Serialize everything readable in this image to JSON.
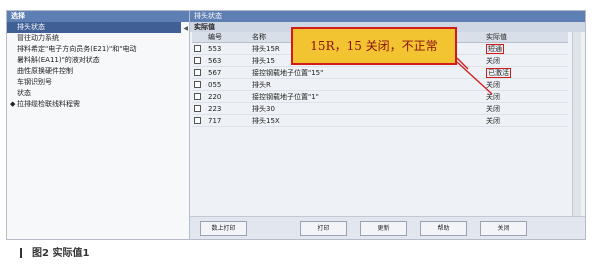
{
  "left_panel": {
    "title": "选择",
    "items": [
      "排头状态",
      "冒往动力系统",
      "排料希定\"电子方向员务(E21)\"和\"电动",
      "暑料斛(EA11)\"的液对状态",
      "曲性原换硬件控制",
      "车钢识别号",
      "状态",
      "拉排缆检联线料程需"
    ]
  },
  "right_panel": {
    "title": "排头状态",
    "subtitle": "实际值",
    "columns": [
      "编号",
      "名称",
      "实际值"
    ],
    "rows": [
      {
        "num": "553",
        "name": "排头15R",
        "value": "短通"
      },
      {
        "num": "563",
        "name": "排头15",
        "value": "关闭"
      },
      {
        "num": "567",
        "name": "接控钢载地子位置\"15\"",
        "value": "已激活"
      },
      {
        "num": "055",
        "name": "排头R",
        "value": "关闭"
      },
      {
        "num": "220",
        "name": "接控钢载地子位置\"1\"",
        "value": "关闭"
      },
      {
        "num": "223",
        "name": "排头30",
        "value": "关闭"
      },
      {
        "num": "717",
        "name": "排头15X",
        "value": "关闭"
      }
    ],
    "buttons": [
      "数上打印",
      "打印",
      "更新",
      "帮助",
      "关闭"
    ]
  },
  "annotation": {
    "text": "15R，15 关闭，不正常",
    "highlight_color": "#d21c1c"
  },
  "caption": {
    "text": "图2  实际值1"
  }
}
